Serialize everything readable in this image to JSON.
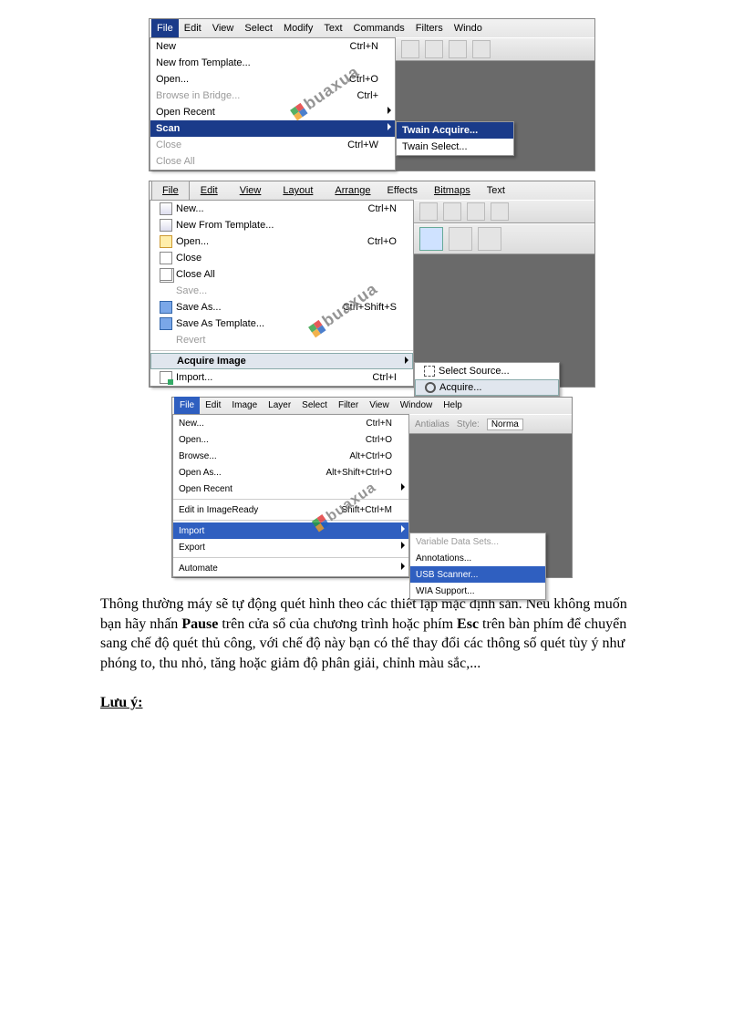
{
  "fig1": {
    "menubar": [
      "File",
      "Edit",
      "View",
      "Select",
      "Modify",
      "Text",
      "Commands",
      "Filters",
      "Windo"
    ],
    "active_index": 0,
    "items": [
      {
        "label": "New",
        "shortcut": "Ctrl+N"
      },
      {
        "label": "New from Template..."
      },
      {
        "label": "Open...",
        "shortcut": "Ctrl+O"
      },
      {
        "label": "Browse in Bridge...",
        "shortcut": "Ctrl+",
        "disabled": true
      },
      {
        "label": "Open Recent",
        "submenu": true
      },
      {
        "label": "Scan",
        "submenu": true,
        "selected": true
      },
      {
        "label": "Close",
        "shortcut": "Ctrl+W",
        "disabled": true
      },
      {
        "label": "Close All",
        "disabled": true
      }
    ],
    "submenu": [
      {
        "label": "Twain Acquire...",
        "selected": true
      },
      {
        "label": "Twain Select..."
      }
    ],
    "watermark": "buaxua"
  },
  "fig2": {
    "menubar": [
      "File",
      "Edit",
      "View",
      "Layout",
      "Arrange",
      "Effects",
      "Bitmaps",
      "Text"
    ],
    "active_index": 0,
    "items": [
      {
        "icon": "new",
        "label": "New...",
        "shortcut": "Ctrl+N",
        "u": "N"
      },
      {
        "icon": "new",
        "label": "New From Template...",
        "u": "F"
      },
      {
        "icon": "open",
        "label": "Open...",
        "shortcut": "Ctrl+O",
        "u": "O"
      },
      {
        "icon": "close",
        "label": "Close",
        "u": "C"
      },
      {
        "icon": "closeall",
        "label": "Close All",
        "u": "l"
      },
      {
        "label": "Save...",
        "disabled": true,
        "u": "S"
      },
      {
        "icon": "save",
        "label": "Save As...",
        "shortcut": "Ctrl+Shift+S",
        "u": "A"
      },
      {
        "icon": "save",
        "label": "Save As Template...",
        "u": "T"
      },
      {
        "label": "Revert",
        "disabled": true,
        "u": "t"
      },
      {
        "sep": true
      },
      {
        "label": "Acquire Image",
        "submenu": true,
        "selected": true,
        "u": "q"
      },
      {
        "icon": "import",
        "label": "Import...",
        "shortcut": "Ctrl+I",
        "u": "I"
      }
    ],
    "submenu": [
      {
        "icon": "sel",
        "label": "Select Source...",
        "u": "S"
      },
      {
        "icon": "acq",
        "label": "Acquire...",
        "selected": true,
        "u": "A"
      }
    ],
    "watermark": "buaxua"
  },
  "fig3": {
    "menubar": [
      "File",
      "Edit",
      "Image",
      "Layer",
      "Select",
      "Filter",
      "View",
      "Window",
      "Help"
    ],
    "active_index": 0,
    "items": [
      {
        "label": "New...",
        "shortcut": "Ctrl+N"
      },
      {
        "label": "Open...",
        "shortcut": "Ctrl+O"
      },
      {
        "label": "Browse...",
        "shortcut": "Alt+Ctrl+O"
      },
      {
        "label": "Open As...",
        "shortcut": "Alt+Shift+Ctrl+O"
      },
      {
        "label": "Open Recent",
        "submenu": true
      },
      {
        "sep": true
      },
      {
        "label": "Edit in ImageReady",
        "shortcut": "Shift+Ctrl+M"
      },
      {
        "sep": true
      },
      {
        "label": "Import",
        "submenu": true,
        "selected": true
      },
      {
        "label": "Export",
        "submenu": true
      },
      {
        "sep": true
      },
      {
        "label": "Automate",
        "submenu": true
      }
    ],
    "submenu": [
      {
        "label": "Variable Data Sets...",
        "disabled": true
      },
      {
        "label": "Annotations..."
      },
      {
        "label": "USB Scanner...",
        "selected": true
      },
      {
        "label": "WIA Support..."
      }
    ],
    "toolbar_right": {
      "antialias": "Antialias",
      "style_label": "Style:",
      "style_value": "Norma"
    },
    "watermark": "buaxua"
  },
  "body": {
    "p_before1": "Thông thường máy sẽ tự động quét hình theo các thiết lập mặc định sẵn. Nếu không muốn bạn hãy nhấn ",
    "b1": "Pause",
    "p_mid1": " trên cửa sổ của chương trình hoặc phím ",
    "b2": "Esc",
    "p_after": " trên bàn phím để chuyển sang chế độ quét thủ công, với chế độ này bạn có thể thay đổi các thông số quét tùy ý như phóng to, thu nhỏ, tăng hoặc giảm độ phân giải, chỉnh màu sắc,...",
    "note": "Lưu ý:"
  }
}
